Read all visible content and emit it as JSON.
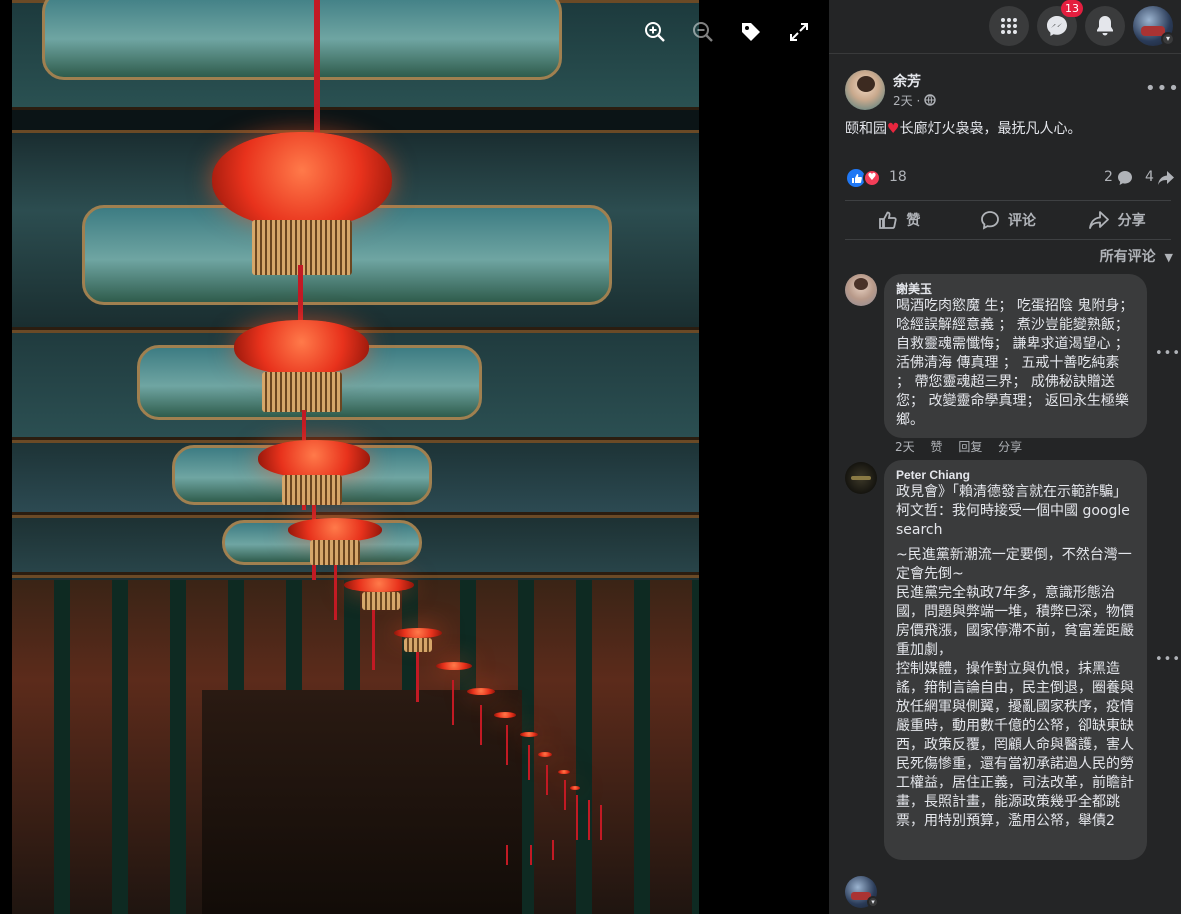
{
  "viewer": {
    "tools": {
      "zoom_in": "zoom-in-icon",
      "zoom_out": "zoom-out-icon",
      "tag": "tag-icon",
      "fullscreen": "fullscreen-icon"
    }
  },
  "topnav": {
    "messenger_badge": "13"
  },
  "post": {
    "author": "余芳",
    "time": "2天",
    "separator": "·",
    "text_before": "颐和园",
    "text_after": "长廊灯火袅袅，最抚凡人心。",
    "reaction_count": "18",
    "comment_count": "2",
    "share_count": "4",
    "actions": {
      "like": "赞",
      "comment": "评论",
      "share": "分享"
    },
    "sort_label": "所有评论"
  },
  "comments": [
    {
      "name": "謝美玉",
      "text": "喝酒吃肉慾魔 生； 吃蛋招陰 鬼附身； 唸經誤解經意義 ； 煮沙豈能變熟飯； 自救靈魂需懺悔； 謙卑求道渴望心 ；活佛清海 傳真理 ； 五戒十善吃純素 ； 帶您靈魂超三界； 成佛秘訣贈送您； 改變靈命學真理； 返回永生極樂鄉。",
      "time": "2天",
      "like": "赞",
      "reply": "回复",
      "share": "分享"
    },
    {
      "name": "Peter Chiang",
      "text": "政見會》「賴清德發言就在示範詐騙」　柯文哲：我何時接受一個中國 google search",
      "text2": "~民進黨新潮流一定要倒，不然台灣一定會先倒~\n民進黨完全執政7年多，意識形態治國，問題與弊端一堆，積弊已深，物價房價飛漲，國家停滯不前，貧富差距嚴重加劇，\n控制媒體，操作對立與仇恨，抹黑造謠，箝制言論自由，民主倒退，圈養與放任網軍與側翼，擾亂國家秩序，疫情嚴重時，動用數千億的公帑，卻缺東缺西，政策反覆，罔顧人命與醫護，害人民死傷慘重，還有當初承諾過人民的勞工權益，居住正義，司法改革，前瞻計畫，長照計畫，能源政策幾乎全都跳票，用特別預算，濫用公帑，舉債2"
    }
  ],
  "colors": {
    "panel_bg": "#242526",
    "bubble_bg": "#3a3b3c",
    "text_primary": "#e4e6eb",
    "text_secondary": "#b0b3b8",
    "badge_red": "#e41e3f",
    "like_blue": "#2078f4",
    "love_red": "#f33e58"
  }
}
